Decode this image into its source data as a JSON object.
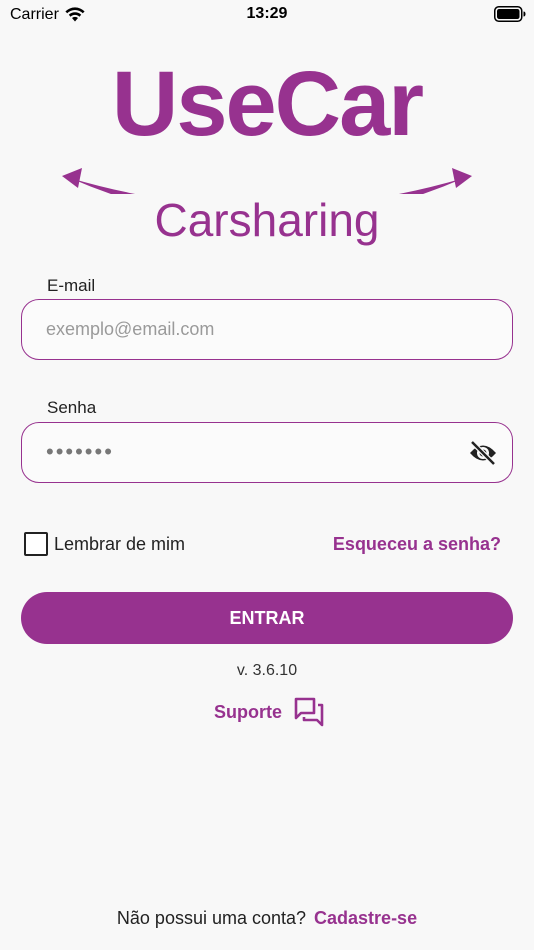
{
  "status_bar": {
    "carrier": "Carrier",
    "time": "13:29",
    "wifi_icon": "wifi-icon",
    "battery_icon": "battery-icon"
  },
  "logo": {
    "brand": "UseCar",
    "tagline": "Carsharing"
  },
  "form": {
    "email": {
      "label": "E-mail",
      "placeholder": "exemplo@email.com",
      "value": ""
    },
    "password": {
      "label": "Senha",
      "value": "•••••••",
      "toggle_icon": "eye-off-icon"
    },
    "remember_label": "Lembrar de mim",
    "remember_checked": false,
    "forgot_label": "Esqueceu a senha?",
    "submit_label": "ENTRAR"
  },
  "version": "v. 3.6.10",
  "support": {
    "label": "Suporte",
    "icon": "chat-bubbles-icon"
  },
  "footer": {
    "prompt": "Não possui uma conta?",
    "signup_label": "Cadastre-se"
  },
  "colors": {
    "brand": "#97328f",
    "background": "#f8f8f8"
  }
}
